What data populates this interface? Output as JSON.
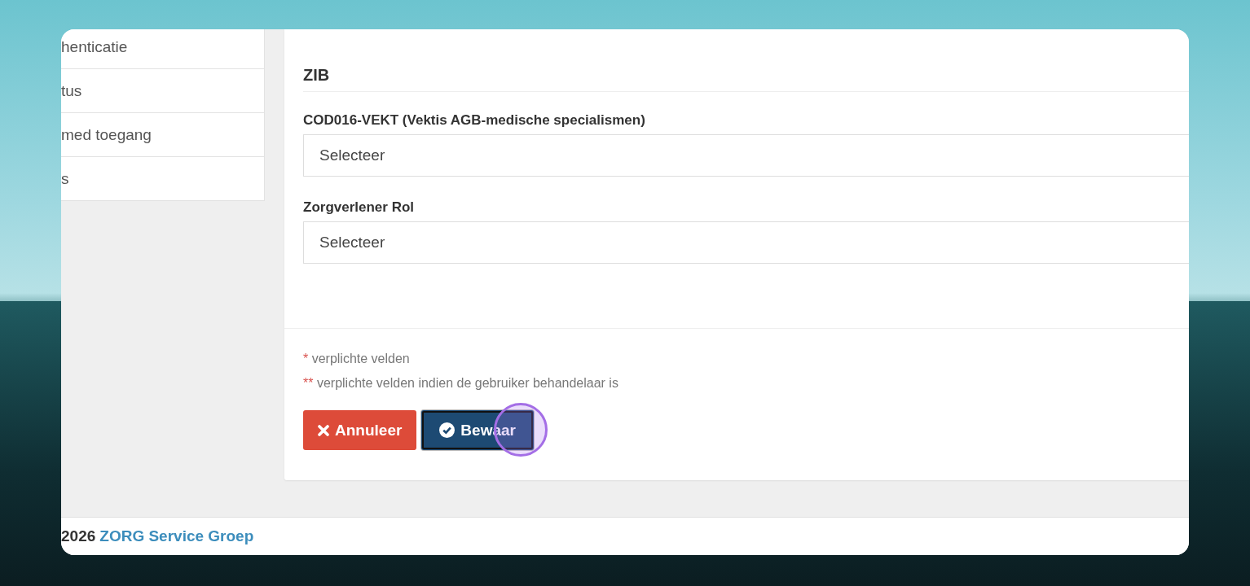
{
  "sidebar": {
    "items": [
      {
        "label": "henticatie"
      },
      {
        "label": "tus"
      },
      {
        "label": "med toegang"
      },
      {
        "label": "s"
      }
    ]
  },
  "section": {
    "title": "ZIB"
  },
  "fields": [
    {
      "label": "COD016-VEKT (Vektis AGB-medische specialismen)",
      "placeholder": "Selecteer"
    },
    {
      "label": "Zorgverlener Rol",
      "placeholder": "Selecteer"
    }
  ],
  "notes": [
    {
      "mark": "*",
      "text": "verplichte velden"
    },
    {
      "mark": "**",
      "text": "verplichte velden indien de gebruiker behandelaar is"
    }
  ],
  "buttons": [
    {
      "kind": "cancel",
      "label": "Annuleer",
      "focused": false
    },
    {
      "kind": "save",
      "label": "Bewaar",
      "focused": true
    }
  ],
  "footer": {
    "year": "2026",
    "link": "ZORG Service Groep"
  }
}
